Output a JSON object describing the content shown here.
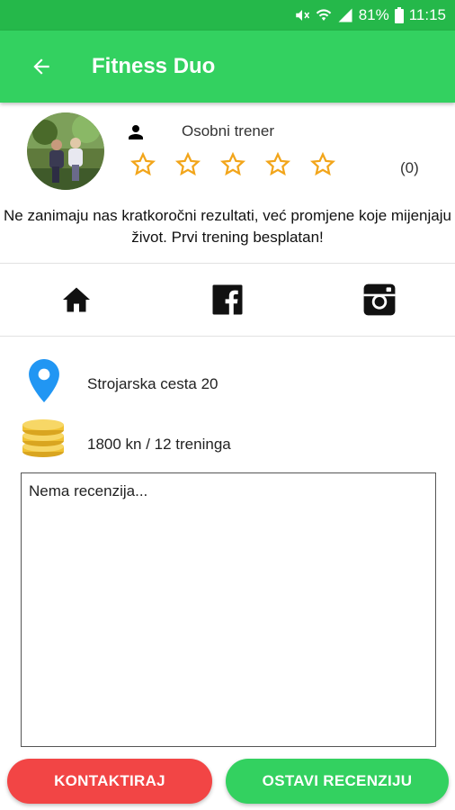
{
  "status": {
    "battery": "81%",
    "time": "11:15"
  },
  "header": {
    "title": "Fitness Duo"
  },
  "profile": {
    "subtitle": "Osobni trener",
    "rating_count": "(0)",
    "stars_total": 5,
    "stars_filled": 0,
    "description": "Ne zanimaju nas kratkoročni rezultati, već promjene koje mijenjaju život. Prvi trening besplatan!"
  },
  "social": [
    "home-icon",
    "facebook-icon",
    "instagram-icon"
  ],
  "info": {
    "address": "Strojarska cesta 20",
    "price": "1800 kn / 12 treninga"
  },
  "reviews": {
    "empty_text": "Nema recenzija..."
  },
  "actions": {
    "contact_label": "KONTAKTIRAJ",
    "review_label": "OSTAVI RECENZIJU"
  },
  "colors": {
    "primary": "#33d160",
    "status": "#25b84a",
    "danger": "#f24545",
    "star": "#f2a51a",
    "pin": "#2196f3",
    "coins": "#f1c232"
  }
}
